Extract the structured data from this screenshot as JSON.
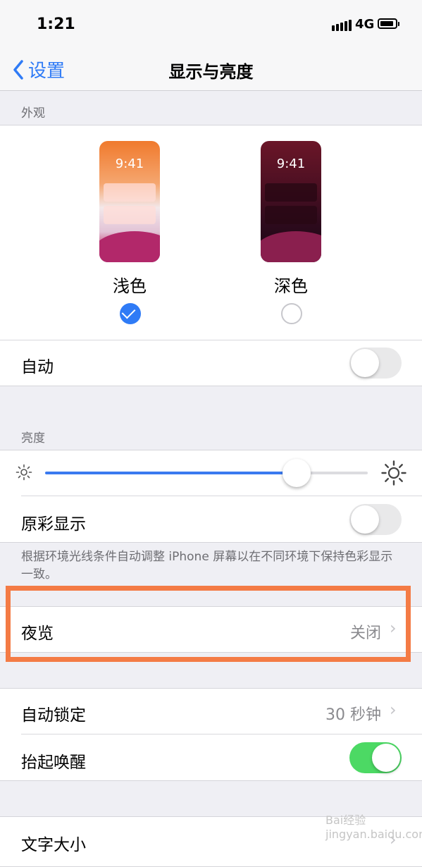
{
  "status_bar": {
    "time": "1:21",
    "network": "4G",
    "signal_icon": "signal-bars-icon",
    "battery_icon": "battery-icon"
  },
  "nav": {
    "back_label": "设置",
    "title": "显示与亮度"
  },
  "appearance": {
    "header": "外观",
    "light": {
      "label": "浅色",
      "preview_time": "9:41",
      "selected": true
    },
    "dark": {
      "label": "深色",
      "preview_time": "9:41",
      "selected": false
    },
    "automatic": {
      "label": "自动",
      "on": false
    }
  },
  "brightness": {
    "header": "亮度",
    "level": 0.78,
    "low_icon": "sun-small-icon",
    "high_icon": "sun-large-icon",
    "true_tone": {
      "label": "原彩显示",
      "on": false
    },
    "footnote": "根据环境光线条件自动调整 iPhone 屏幕以在不同环境下保持色彩显示一致。"
  },
  "night_shift": {
    "label": "夜览",
    "value": "关闭"
  },
  "lock": {
    "auto_lock": {
      "label": "自动锁定",
      "value": "30 秒钟"
    },
    "raise_to_wake": {
      "label": "抬起唤醒",
      "on": true
    }
  },
  "text_size": {
    "label": "文字大小"
  },
  "watermark": "Bai经验 jingyan.baidu.com",
  "colors": {
    "accent": "#2f7bf6",
    "toggle_on": "#4cd964",
    "highlight": "#f47b45",
    "background": "#efeff4"
  }
}
